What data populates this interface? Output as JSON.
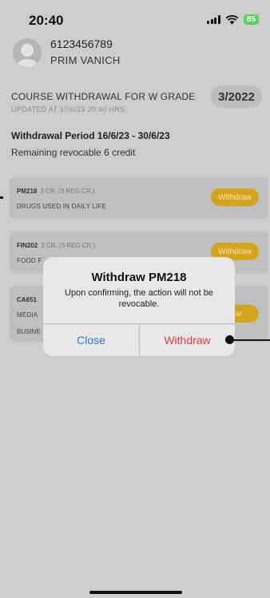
{
  "status_bar": {
    "time": "20:40",
    "battery": "85"
  },
  "profile": {
    "id": "6123456789",
    "name": "PRIM VANICH"
  },
  "header": {
    "title": "COURSE WITHDRAWAL FOR W GRADE",
    "updated": "UPDATED AT 17/6/23 20:40 HRS.",
    "term": "3/2022",
    "period": "Withdrawal Period 16/6/23 - 30/6/23",
    "remaining": "Remaining revocable 6 credit"
  },
  "courses": [
    {
      "code": "PM218",
      "credit": "3 CR. (3 REG CR.)",
      "name": "DRUGS USED IN DAILY LIFE",
      "name2": "",
      "button": "Withdraw"
    },
    {
      "code": "FIN202",
      "credit": "3 CR. (3 REG CR.)",
      "name": "FOOD F",
      "name2": "",
      "button": "Withdraw"
    },
    {
      "code": "CA651",
      "credit": "",
      "name": "MEDIA",
      "name2": "BUSINE",
      "button": "raw"
    }
  ],
  "dialog": {
    "title": "Withdraw PM218",
    "message": "Upon confirming, the action will not be revocable.",
    "close": "Close",
    "confirm": "Withdraw"
  },
  "colors": {
    "accent": "#d4a51b",
    "confirm": "#e23b3b",
    "close": "#2a78d6",
    "battery": "#5ad35a"
  }
}
